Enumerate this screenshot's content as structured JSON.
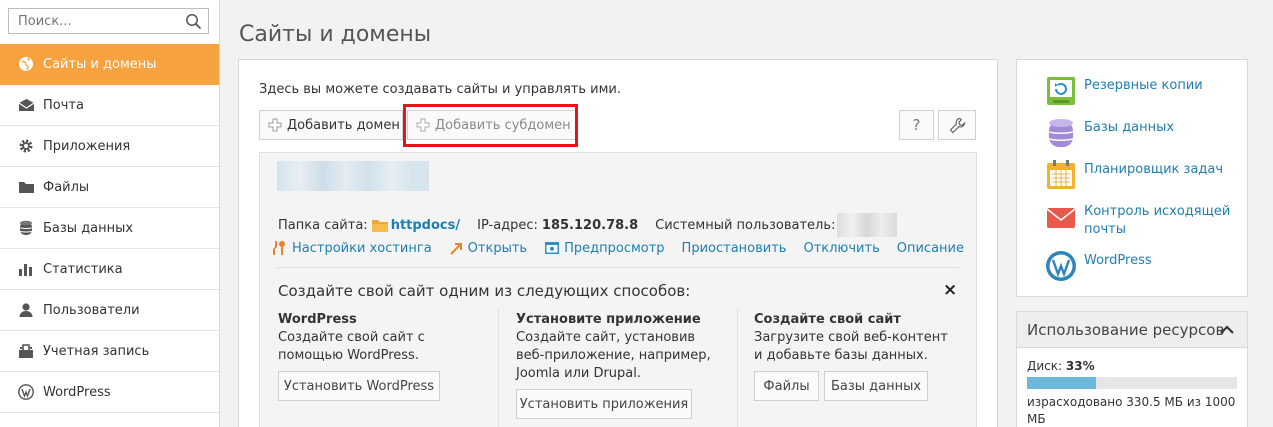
{
  "search": {
    "placeholder": "Поиск..."
  },
  "sidebar": {
    "items": [
      {
        "label": "Сайты и домены",
        "icon": "globe-icon",
        "active": true
      },
      {
        "label": "Почта",
        "icon": "envelope-icon"
      },
      {
        "label": "Приложения",
        "icon": "gear-icon"
      },
      {
        "label": "Файлы",
        "icon": "folder-icon"
      },
      {
        "label": "Базы данных",
        "icon": "database-icon"
      },
      {
        "label": "Статистика",
        "icon": "bar-chart-icon"
      },
      {
        "label": "Пользователи",
        "icon": "user-icon"
      },
      {
        "label": "Учетная запись",
        "icon": "account-icon"
      },
      {
        "label": "WordPress",
        "icon": "wordpress-icon"
      }
    ]
  },
  "page": {
    "title": "Сайты и домены"
  },
  "main": {
    "intro": "Здесь вы можете создавать сайты и управлять ими.",
    "add_domain": "Добавить домен",
    "add_subdomain": "Добавить субдомен",
    "help_label": "?",
    "domain": {
      "folder_label": "Папка сайта:",
      "folder_value": "httpdocs/",
      "ip_label": "IP-адрес:",
      "ip_value": "185.120.78.8",
      "sysuser_label": "Системный пользователь:",
      "actions": [
        {
          "label": "Настройки хостинга",
          "icon": "hosting-settings-icon"
        },
        {
          "label": "Открыть",
          "icon": "open-icon"
        },
        {
          "label": "Предпросмотр",
          "icon": "preview-icon"
        },
        {
          "label": "Приостановить",
          "icon": ""
        },
        {
          "label": "Отключить",
          "icon": ""
        },
        {
          "label": "Описание",
          "icon": ""
        }
      ],
      "create_title": "Создайте свой сайт одним из следующих способов:",
      "close_label": "×",
      "options": [
        {
          "title": "WordPress",
          "text": "Создайте свой сайт с помощью WordPress.",
          "buttons": [
            "Установить WordPress"
          ]
        },
        {
          "title": "Установите приложение",
          "text": "Создайте сайт, установив веб-приложение, например, Joomla или Drupal.",
          "buttons": [
            "Установить приложения"
          ]
        },
        {
          "title": "Создайте свой сайт",
          "text": "Загрузите свой веб-контент и добавьте базы данных.",
          "buttons": [
            "Файлы",
            "Базы данных"
          ]
        }
      ]
    }
  },
  "right": {
    "items": [
      {
        "label": "Резервные копии",
        "icon": "backup-icon"
      },
      {
        "label": "Базы данных",
        "icon": "database-icon"
      },
      {
        "label": "Планировщик задач",
        "icon": "calendar-icon"
      },
      {
        "label": "Контроль исходящей почты",
        "icon": "mail-icon"
      },
      {
        "label": "WordPress",
        "icon": "wordpress-icon"
      }
    ]
  },
  "resources": {
    "title": "Использование ресурсов",
    "disk_label": "Диск:",
    "disk_percent": "33%",
    "disk_fraction": 0.33,
    "used_text": "израсходовано 330.5 МБ из 1000 МБ"
  },
  "colors": {
    "accent": "#f6a23e",
    "link": "#1d7fb0",
    "highlight": "#e0161c"
  }
}
